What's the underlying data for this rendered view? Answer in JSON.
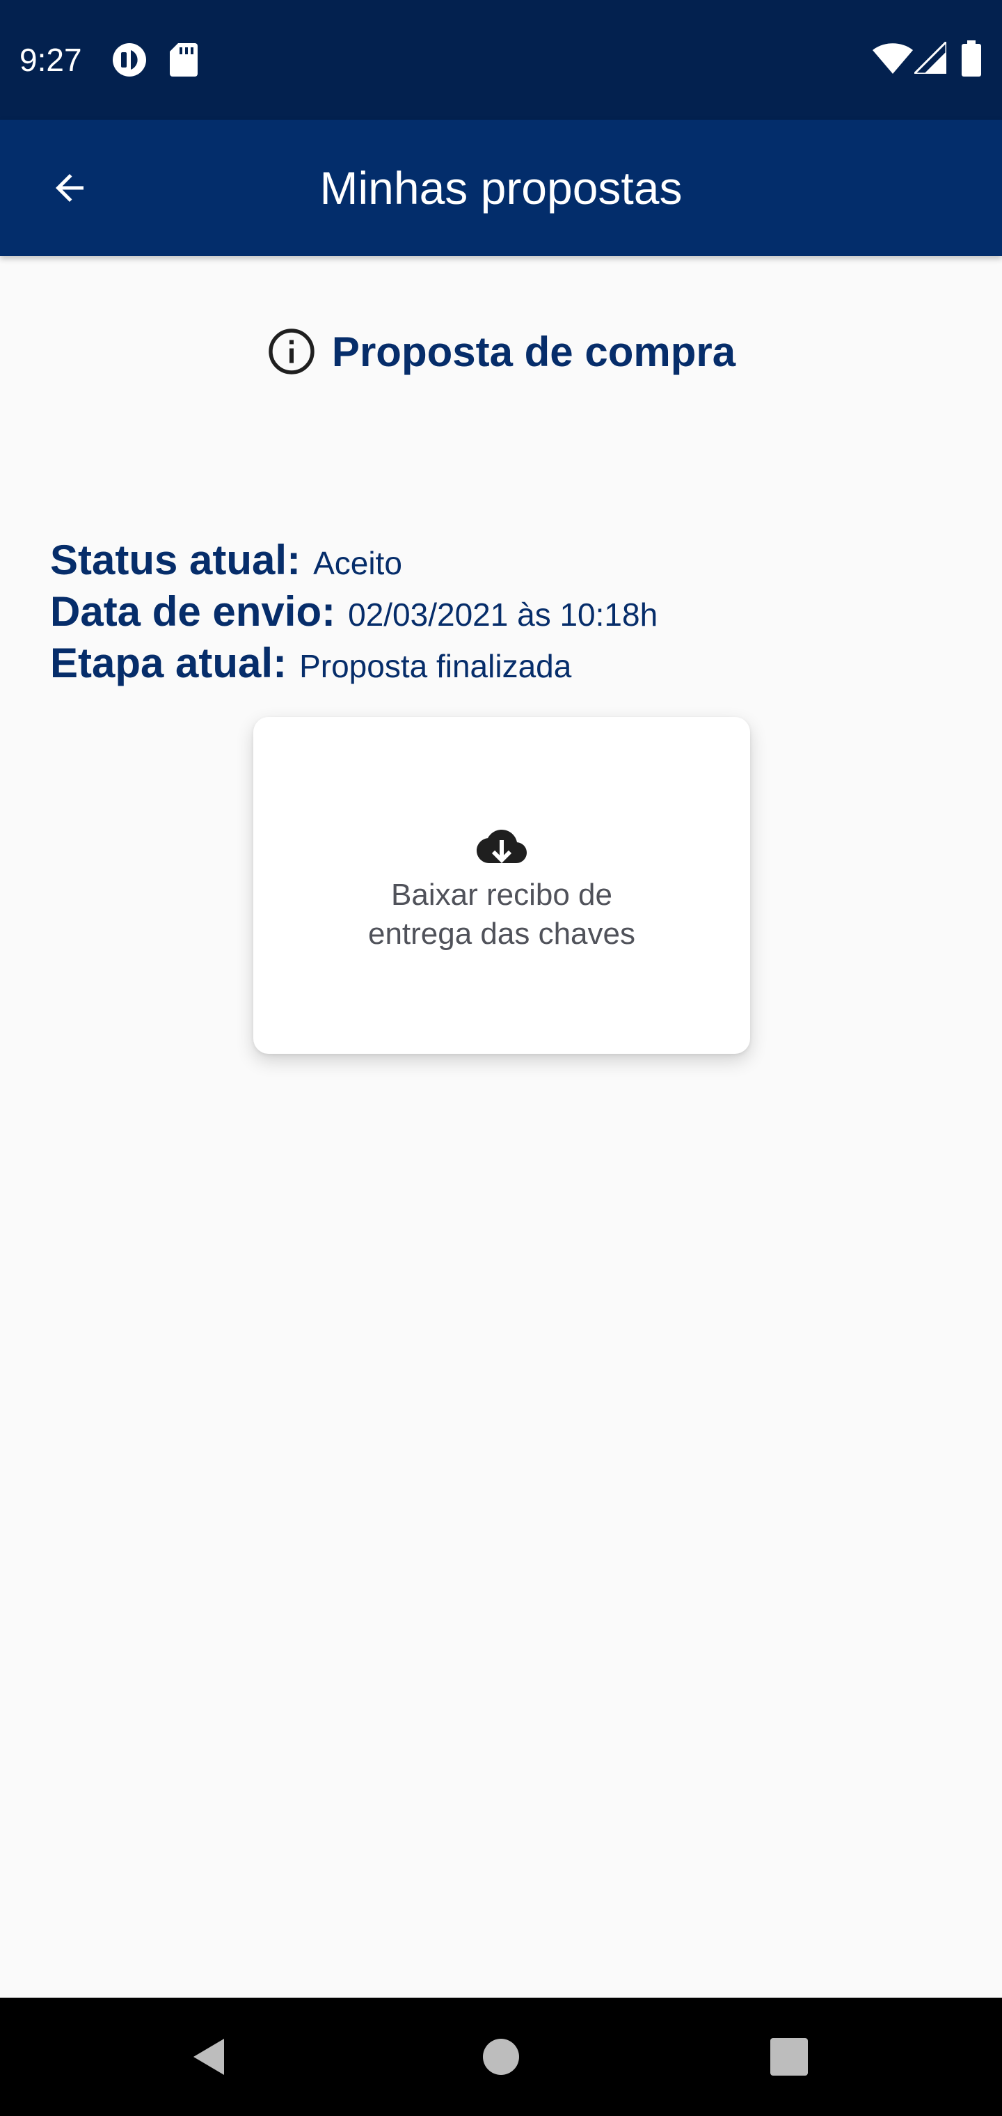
{
  "status_bar": {
    "time": "9:27",
    "left_icons": [
      "data-saver-icon",
      "sd-card-icon"
    ],
    "right_icons": [
      "wifi-icon",
      "signal-icon",
      "battery-icon"
    ]
  },
  "app_bar": {
    "title": "Minhas propostas",
    "back_icon": "arrow-back-icon"
  },
  "section": {
    "icon": "info-icon",
    "title": "Proposta de compra"
  },
  "details": {
    "status_label": "Status atual:",
    "status_value": "Aceito",
    "date_label": "Data de envio:",
    "date_value": "02/03/2021 às 10:18h",
    "stage_label": "Etapa atual:",
    "stage_value": "Proposta finalizada"
  },
  "download_card": {
    "icon": "cloud-download-icon",
    "label": "Baixar recibo de\nentrega das chaves"
  },
  "nav_bar": {
    "icons": [
      "nav-back-icon",
      "nav-home-icon",
      "nav-recents-icon"
    ]
  },
  "colors": {
    "status_bar_bg": "#03214f",
    "app_bar_bg": "#032d6b",
    "primary_text": "#062d6a",
    "page_bg": "#fafafa"
  }
}
